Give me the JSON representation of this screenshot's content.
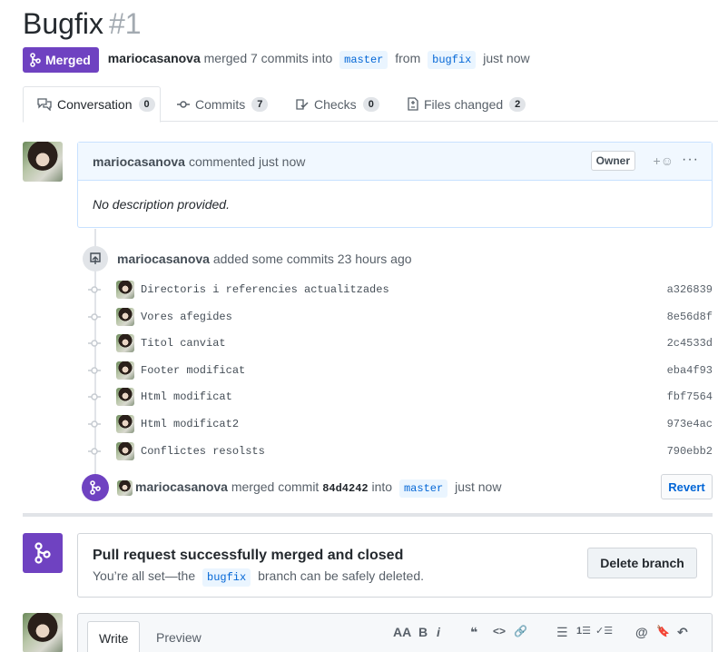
{
  "header": {
    "title": "Bugfix",
    "number": "#1",
    "badge": "Merged",
    "author": "mariocasanova",
    "merged_text_1": "merged 7 commits into",
    "base_branch": "master",
    "from_text": "from",
    "head_branch": "bugfix",
    "when": "just now"
  },
  "tabs": [
    {
      "label": "Conversation",
      "count": "0"
    },
    {
      "label": "Commits",
      "count": "7"
    },
    {
      "label": "Checks",
      "count": "0"
    },
    {
      "label": "Files changed",
      "count": "2"
    }
  ],
  "comment": {
    "author": "mariocasanova",
    "action": "commented just now",
    "role": "Owner",
    "reaction": "+☺",
    "menu": "···",
    "body": "No description provided."
  },
  "commits_event": {
    "author": "mariocasanova",
    "text": "added some commits 23 hours ago",
    "commits": [
      {
        "message": "Directoris i referencies actualitzades",
        "sha": "a326839"
      },
      {
        "message": "Vores afegides",
        "sha": "8e56d8f"
      },
      {
        "message": "Titol canviat",
        "sha": "2c4533d"
      },
      {
        "message": "Footer modificat",
        "sha": "eba4f93"
      },
      {
        "message": "Html modificat",
        "sha": "fbf7564"
      },
      {
        "message": "Html modificat2",
        "sha": "973e4ac"
      },
      {
        "message": "Conflictes resolsts",
        "sha": "790ebb2"
      }
    ]
  },
  "merge_event": {
    "author": "mariocasanova",
    "text": "merged commit",
    "sha": "84d4242",
    "into": "into",
    "branch": "master",
    "when": "just now",
    "revert_label": "Revert"
  },
  "merged_box": {
    "title": "Pull request successfully merged and closed",
    "sub_before": "You’re all set—the",
    "branch": "bugfix",
    "sub_after": "branch can be safely deleted.",
    "delete_label": "Delete branch"
  },
  "editor": {
    "write_label": "Write",
    "preview_label": "Preview",
    "tools": [
      "AA",
      "B",
      "i",
      "❝",
      "<>",
      "🔗",
      "☰",
      "1☰",
      "✓☰",
      "@",
      "🔖",
      "↶"
    ]
  },
  "colors": {
    "purple": "#6f42c1",
    "blue": "#0366d6",
    "branch_bg": "#eaf5ff"
  }
}
